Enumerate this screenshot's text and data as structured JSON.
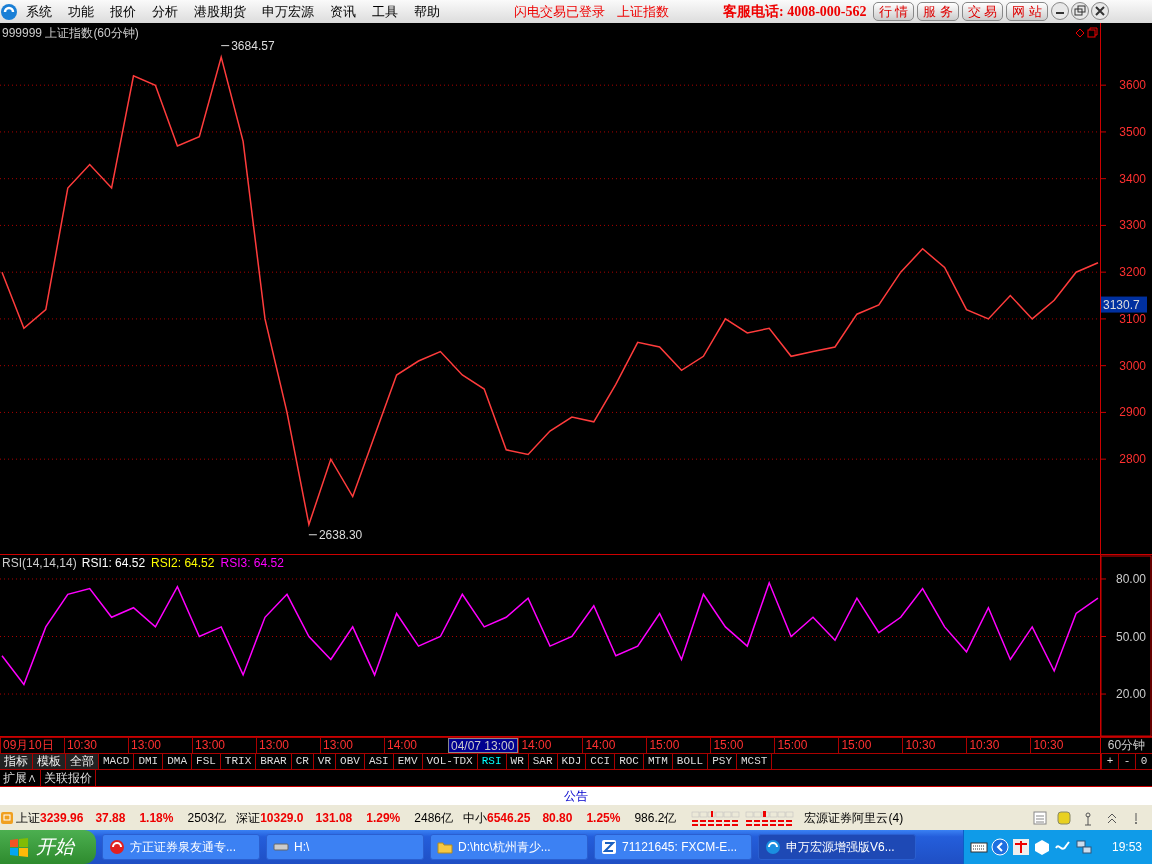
{
  "menu_bar": {
    "items": [
      "系统",
      "功能",
      "报价",
      "分析",
      "港股期货",
      "申万宏源",
      "资讯",
      "工具",
      "帮助"
    ],
    "notices": [
      "闪电交易已登录",
      "上证指数"
    ],
    "hotline": "客服电话: 4008-000-562",
    "buttons": [
      "行 情",
      "服 务",
      "交 易",
      "网 站"
    ]
  },
  "price_chart": {
    "title": "999999 上证指数(60分钟)",
    "chart_data": {
      "type": "line",
      "ylim": [
        2595,
        3733
      ],
      "grid": true,
      "yticks": [
        2800,
        2900,
        3000,
        3100,
        3200,
        3300,
        3400,
        3500,
        3600
      ],
      "series": [
        {
          "color": "#ff3c3c",
          "values": [
            3200,
            3080,
            3120,
            3380,
            3430,
            3380,
            3620,
            3600,
            3470,
            3490,
            3660,
            3480,
            3100,
            2900,
            2660,
            2800,
            2720,
            2850,
            2980,
            3010,
            3030,
            2980,
            2950,
            2820,
            2810,
            2860,
            2890,
            2880,
            2960,
            3050,
            3040,
            2990,
            3020,
            3100,
            3070,
            3080,
            3020,
            3030,
            3040,
            3110,
            3130,
            3200,
            3250,
            3210,
            3120,
            3100,
            3150,
            3100,
            3140,
            3200,
            3220
          ]
        }
      ]
    },
    "high_label": "3684.57",
    "low_label": "2638.30",
    "last_price": "3130.7"
  },
  "rsi_chart": {
    "title": "RSI(14,14,14)",
    "legend": [
      {
        "label": "RSI1:",
        "reading": "64.52",
        "color": "#ffffff"
      },
      {
        "label": "RSI2:",
        "reading": "64.52",
        "color": "#ffff00"
      },
      {
        "label": "RSI3:",
        "reading": "64.52",
        "color": "#ff00ff"
      }
    ],
    "chart_data": {
      "type": "line",
      "ylim": [
        -2.4,
        92.5
      ],
      "grid": true,
      "yticks": [
        {
          "value": 20,
          "label": "20.00"
        },
        {
          "value": 50,
          "label": "50.00"
        },
        {
          "value": 80,
          "label": "80.00"
        }
      ],
      "series": [
        {
          "color": "#ff00ff",
          "values": [
            40,
            25,
            55,
            72,
            75,
            60,
            65,
            55,
            76,
            50,
            55,
            30,
            60,
            72,
            50,
            38,
            55,
            30,
            62,
            45,
            50,
            72,
            55,
            60,
            70,
            45,
            50,
            66,
            40,
            45,
            62,
            38,
            72,
            55,
            45,
            78,
            50,
            60,
            48,
            70,
            52,
            60,
            75,
            55,
            42,
            65,
            38,
            55,
            32,
            62,
            70
          ]
        }
      ]
    }
  },
  "time_axis": {
    "labels": [
      {
        "text": "09月10日",
        "selected": false
      },
      {
        "text": "10:30",
        "selected": false
      },
      {
        "text": "13:00",
        "selected": false
      },
      {
        "text": "13:00",
        "selected": false
      },
      {
        "text": "13:00",
        "selected": false
      },
      {
        "text": "13:00",
        "selected": false
      },
      {
        "text": "14:00",
        "selected": false
      },
      {
        "text": "04/07 13:00",
        "selected": true
      },
      {
        "text": "14:00",
        "selected": false
      },
      {
        "text": "14:00",
        "selected": false
      },
      {
        "text": "15:00",
        "selected": false
      },
      {
        "text": "15:00",
        "selected": false
      },
      {
        "text": "15:00",
        "selected": false
      },
      {
        "text": "15:00",
        "selected": false
      },
      {
        "text": "10:30",
        "selected": false
      },
      {
        "text": "10:30",
        "selected": false
      },
      {
        "text": "10:30",
        "selected": false
      }
    ],
    "period": "60分钟"
  },
  "indicator_tabs": [
    {
      "label": "指标",
      "kind": "menu",
      "selected": false
    },
    {
      "label": "模板",
      "kind": "menu",
      "selected": false
    },
    {
      "label": "全部",
      "kind": "menu",
      "selected": false
    },
    {
      "label": "MACD",
      "kind": "indicator",
      "selected": false
    },
    {
      "label": "DMI",
      "kind": "indicator",
      "selected": false
    },
    {
      "label": "DMA",
      "kind": "indicator",
      "selected": false
    },
    {
      "label": "FSL",
      "kind": "indicator",
      "selected": false
    },
    {
      "label": "TRIX",
      "kind": "indicator",
      "selected": false
    },
    {
      "label": "BRAR",
      "kind": "indicator",
      "selected": false
    },
    {
      "label": "CR",
      "kind": "indicator",
      "selected": false
    },
    {
      "label": "VR",
      "kind": "indicator",
      "selected": false
    },
    {
      "label": "OBV",
      "kind": "indicator",
      "selected": false
    },
    {
      "label": "ASI",
      "kind": "indicator",
      "selected": false
    },
    {
      "label": "EMV",
      "kind": "indicator",
      "selected": false
    },
    {
      "label": "VOL-TDX",
      "kind": "indicator",
      "selected": false
    },
    {
      "label": "RSI",
      "kind": "indicator",
      "selected": true
    },
    {
      "label": "WR",
      "kind": "indicator",
      "selected": false
    },
    {
      "label": "SAR",
      "kind": "indicator",
      "selected": false
    },
    {
      "label": "KDJ",
      "kind": "indicator",
      "selected": false
    },
    {
      "label": "CCI",
      "kind": "indicator",
      "selected": false
    },
    {
      "label": "ROC",
      "kind": "indicator",
      "selected": false
    },
    {
      "label": "MTM",
      "kind": "indicator",
      "selected": false
    },
    {
      "label": "BOLL",
      "kind": "indicator",
      "selected": false
    },
    {
      "label": "PSY",
      "kind": "indicator",
      "selected": false
    },
    {
      "label": "MCST",
      "kind": "indicator",
      "selected": false
    }
  ],
  "zoom_buttons": [
    "+",
    "-",
    "0"
  ],
  "extra_tabs": [
    "扩展∧",
    "关联报价"
  ],
  "notice_bar": "公告",
  "status_bar": {
    "quotes": [
      {
        "name": "上证",
        "price": "3239.96",
        "change": "37.88",
        "percent": "1.18%",
        "volume": "2503亿"
      },
      {
        "name": "深证",
        "price": "10329.0",
        "change": "131.08",
        "percent": "1.29%",
        "volume": "2486亿"
      },
      {
        "name": "中小",
        "price": "6546.25",
        "change": "80.80",
        "percent": "1.25%",
        "volume": "986.2亿"
      }
    ],
    "server": "宏源证券阿里云(4)"
  },
  "taskbar": {
    "start": "开始",
    "tasks": [
      {
        "label": "方正证券泉友通专...",
        "kind": "swirl",
        "selected": false
      },
      {
        "label": "H:\\",
        "kind": "drive",
        "selected": false
      },
      {
        "label": "D:\\htc\\杭州青少...",
        "kind": "folder",
        "selected": false
      },
      {
        "label": "71121645: FXCM-E...",
        "kind": "z-logo",
        "selected": false
      },
      {
        "label": "申万宏源增强版V6...",
        "kind": "app-logo",
        "selected": true
      }
    ],
    "clock": "19:53"
  }
}
